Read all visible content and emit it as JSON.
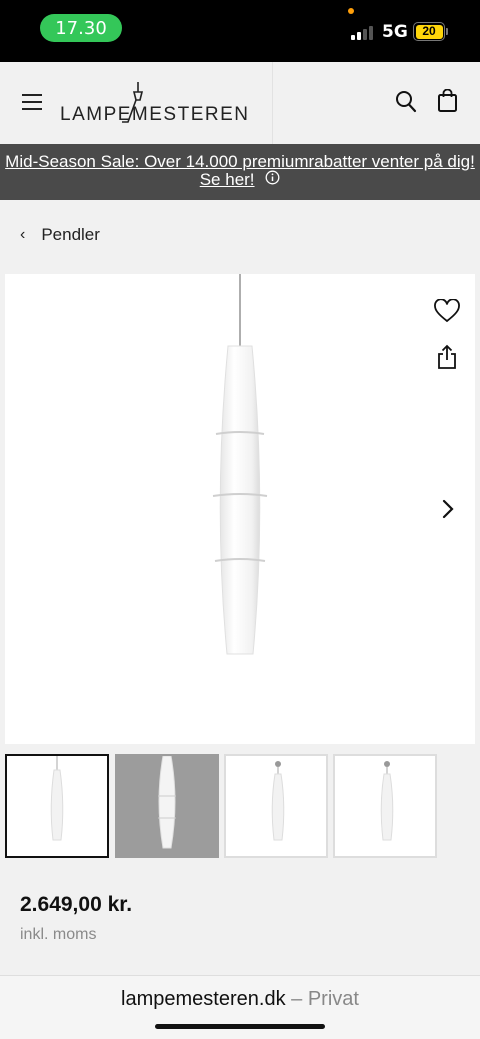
{
  "status_bar": {
    "time": "17.30",
    "network": "5G",
    "battery": "20"
  },
  "header": {
    "logo_text": "LAMPEMESTEREN"
  },
  "promo": {
    "text": "Mid-Season Sale: Over 14.000 premiumrabatter venter på dig! Se her!"
  },
  "breadcrumb": {
    "label": "Pendler"
  },
  "product": {
    "price": "2.649,00 kr.",
    "vat_note": "inkl. moms",
    "thumbnail_count": 4
  },
  "browser": {
    "domain": "lampemesteren.dk",
    "separator": "–",
    "mode": "Privat"
  },
  "icons": [
    "menu-icon",
    "search-icon",
    "bag-icon",
    "info-icon",
    "chevron-left-icon",
    "heart-icon",
    "share-icon",
    "chevron-right-icon"
  ]
}
